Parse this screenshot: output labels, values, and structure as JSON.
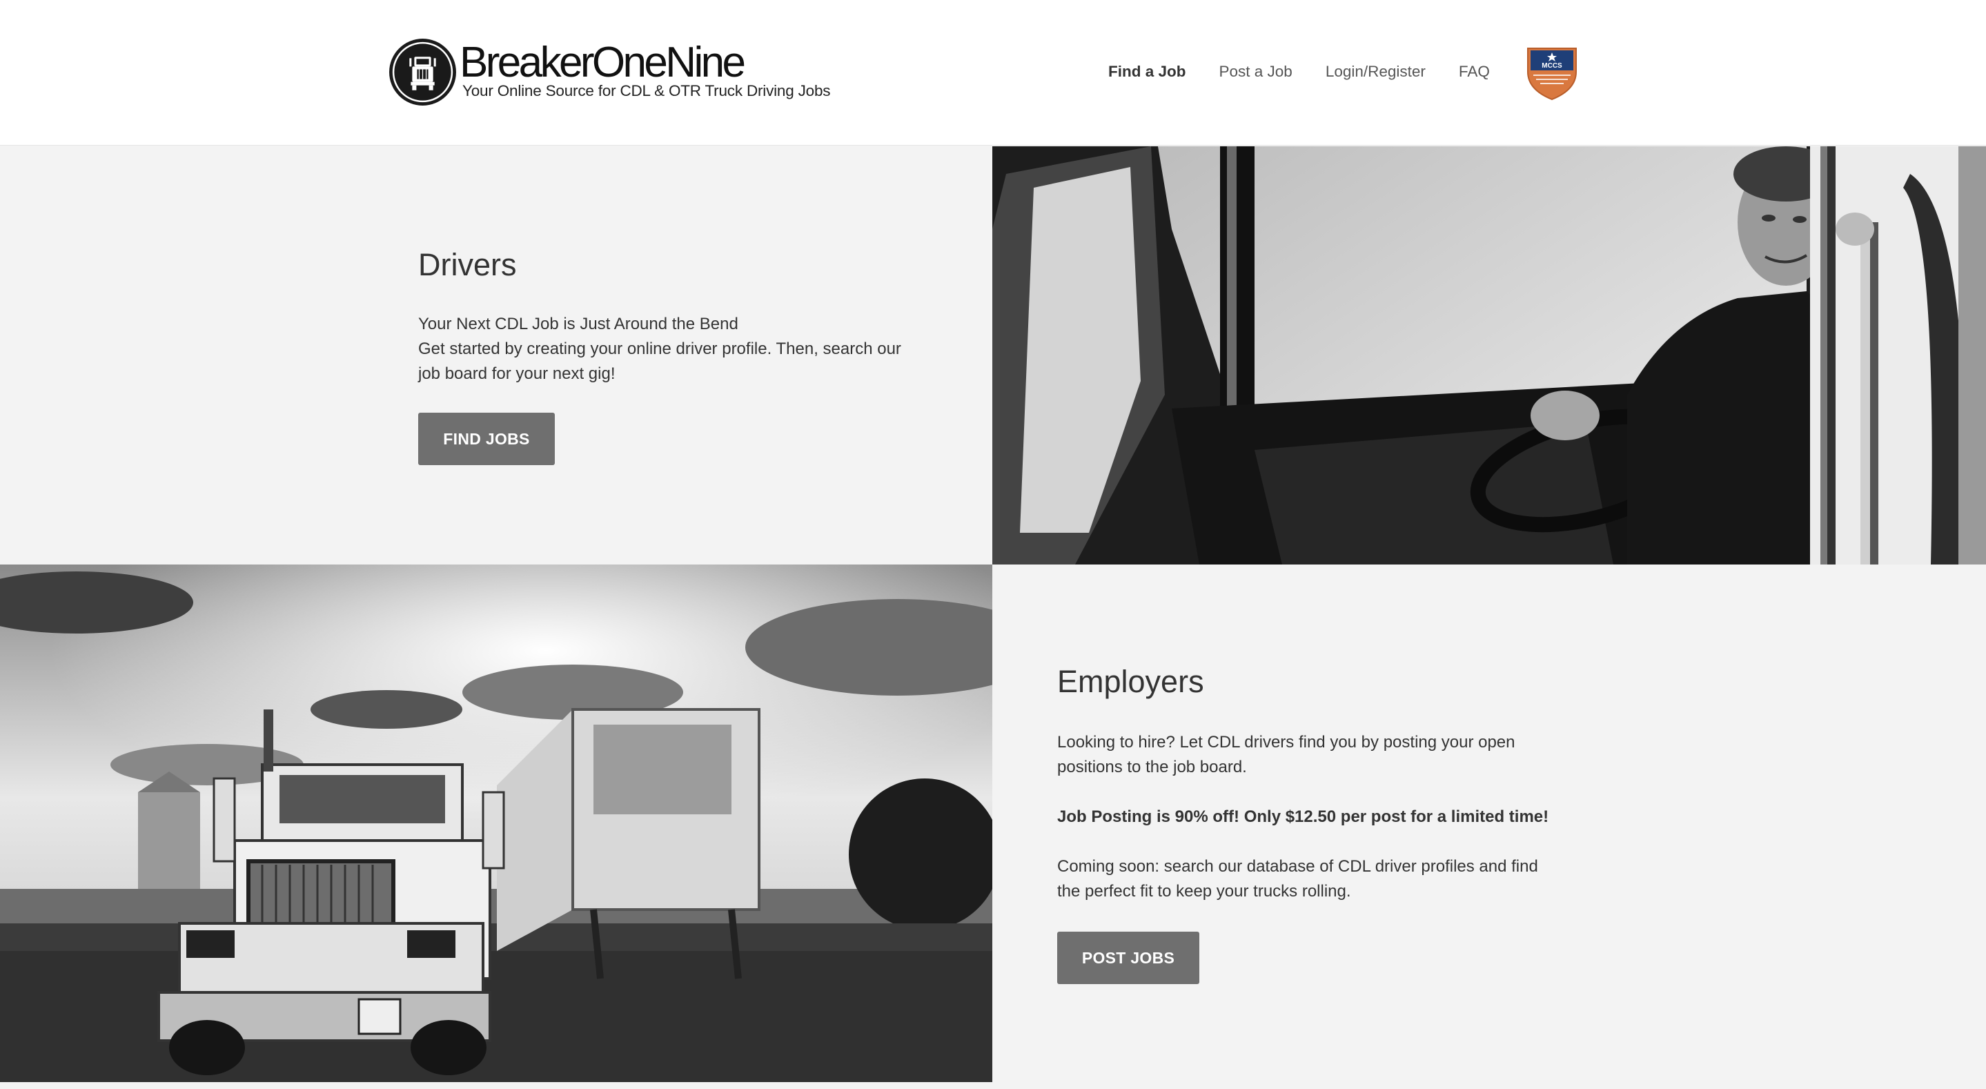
{
  "brand": {
    "name": "BreakerOneNine",
    "tagline": "Your Online Source for CDL & OTR Truck Driving Jobs"
  },
  "nav": {
    "items": [
      {
        "label": "Find a Job",
        "active": true
      },
      {
        "label": "Post a Job",
        "active": false
      },
      {
        "label": "Login/Register",
        "active": false
      },
      {
        "label": "FAQ",
        "active": false
      }
    ],
    "badge_text": "MCCS"
  },
  "drivers": {
    "title": "Drivers",
    "line1": "Your Next CDL Job is Just Around the Bend",
    "line2": "Get started by creating your online driver profile. Then, search our job board for your next gig!",
    "button_label": "FIND JOBS"
  },
  "employers": {
    "title": "Employers",
    "intro": "Looking to hire? Let CDL drivers find you by posting your open positions to the job board.",
    "promo": "Job Posting is 90% off! Only $12.50 per post for a limited time!",
    "coming_soon": "Coming soon: search our database of CDL driver profiles and find the perfect fit to keep your trucks rolling.",
    "button_label": "POST JOBS"
  },
  "colors": {
    "header_bg": "#ffffff",
    "panel_bg": "#f3f3f3",
    "button_bg": "#6f6f6f",
    "badge_blue": "#1f3f78",
    "badge_orange": "#d9783f"
  }
}
